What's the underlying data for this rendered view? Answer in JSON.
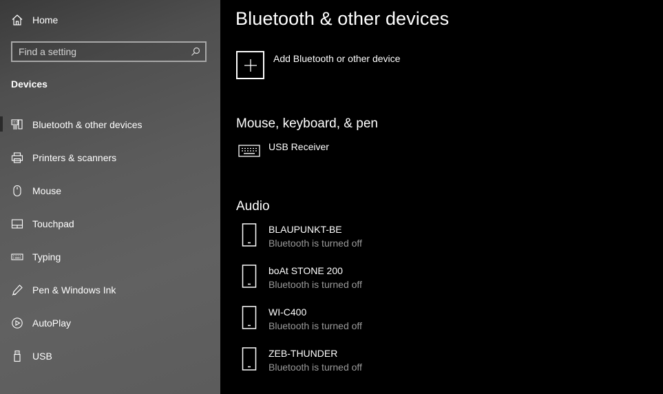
{
  "sidebar": {
    "home_label": "Home",
    "search_placeholder": "Find a setting",
    "section_title": "Devices",
    "items": [
      {
        "label": "Bluetooth & other devices",
        "icon": "bluetooth-devices-icon"
      },
      {
        "label": "Printers & scanners",
        "icon": "printer-icon"
      },
      {
        "label": "Mouse",
        "icon": "mouse-icon"
      },
      {
        "label": "Touchpad",
        "icon": "touchpad-icon"
      },
      {
        "label": "Typing",
        "icon": "keyboard-icon"
      },
      {
        "label": "Pen & Windows Ink",
        "icon": "pen-icon"
      },
      {
        "label": "AutoPlay",
        "icon": "autoplay-icon"
      },
      {
        "label": "USB",
        "icon": "usb-icon"
      }
    ]
  },
  "main": {
    "title": "Bluetooth & other devices",
    "add_label": "Add Bluetooth or other device",
    "groups": {
      "input": {
        "title": "Mouse, keyboard, & pen",
        "devices": [
          {
            "name": "USB Receiver",
            "icon": "keyboard-icon"
          }
        ]
      },
      "audio": {
        "title": "Audio",
        "devices": [
          {
            "name": "BLAUPUNKT-BE",
            "status": "Bluetooth is turned off",
            "icon": "phone-device-icon"
          },
          {
            "name": "boAt STONE 200",
            "status": "Bluetooth is turned off",
            "icon": "phone-device-icon"
          },
          {
            "name": "WI-C400",
            "status": "Bluetooth is turned off",
            "icon": "phone-device-icon"
          },
          {
            "name": "ZEB-THUNDER",
            "status": "Bluetooth is turned off",
            "icon": "phone-device-icon"
          }
        ]
      }
    }
  },
  "colors": {
    "sidebar_bg": "#5a5a5a",
    "main_bg": "#000000",
    "status_text": "#9a9a9a"
  }
}
